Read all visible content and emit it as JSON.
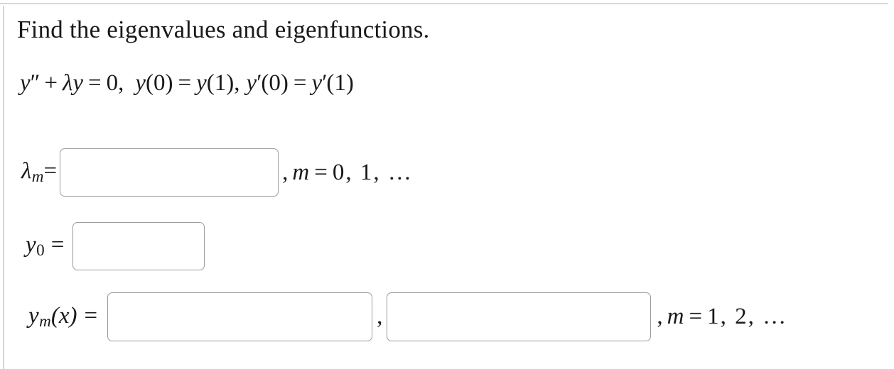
{
  "problem": {
    "prompt": "Find the eigenvalues and eigenfunctions.",
    "equation": {
      "full_text": "y'' + λy = 0,  y(0) = y(1), y'(0) = y'(1)",
      "dependent_variable": "y",
      "second_derivative": "y″",
      "plus": "+",
      "lambda": "λ",
      "equals": "=",
      "zero": "0",
      "comma": ",",
      "bc1_left": "y(0)",
      "bc1_right": "y(1)",
      "bc2_left": "y′(0)",
      "bc2_right": "y′(1)",
      "bc1_text": "y(0) = y(1)",
      "bc2_text": "y′(0) = y′(1)"
    }
  },
  "answers": {
    "eigenvalue_row": {
      "label_symbol": "λ",
      "label_subscript": "m",
      "label_equals": "=",
      "label_text": "λₘ =",
      "input_value": "",
      "input_placeholder": "",
      "index_text": ", m = 0, 1, …",
      "index_comma": ",",
      "index_variable": "m",
      "index_equals": "=",
      "index_values": "0, 1, …"
    },
    "y0_row": {
      "label_symbol": "y",
      "label_subscript": "0",
      "label_equals": "=",
      "label_text": "y₀ =",
      "input_value": "",
      "input_placeholder": ""
    },
    "ym_row": {
      "label_symbol": "y",
      "label_subscript": "m",
      "label_argument": "(x)",
      "label_equals": "=",
      "label_text": "yₘ(x) =",
      "input_value_1": "",
      "input_placeholder_1": "",
      "separator": ",",
      "input_value_2": "",
      "input_placeholder_2": "",
      "index_text": ", m = 1, 2, …",
      "index_comma": ",",
      "index_variable": "m",
      "index_equals": "=",
      "index_values": "1, 2, …"
    }
  },
  "style": {
    "page_background": "#ffffff",
    "text_color": "#1a1a1a",
    "rule_color": "#d4d6d8",
    "input_border_color": "#9b9b9b",
    "input_background": "#ffffff"
  }
}
